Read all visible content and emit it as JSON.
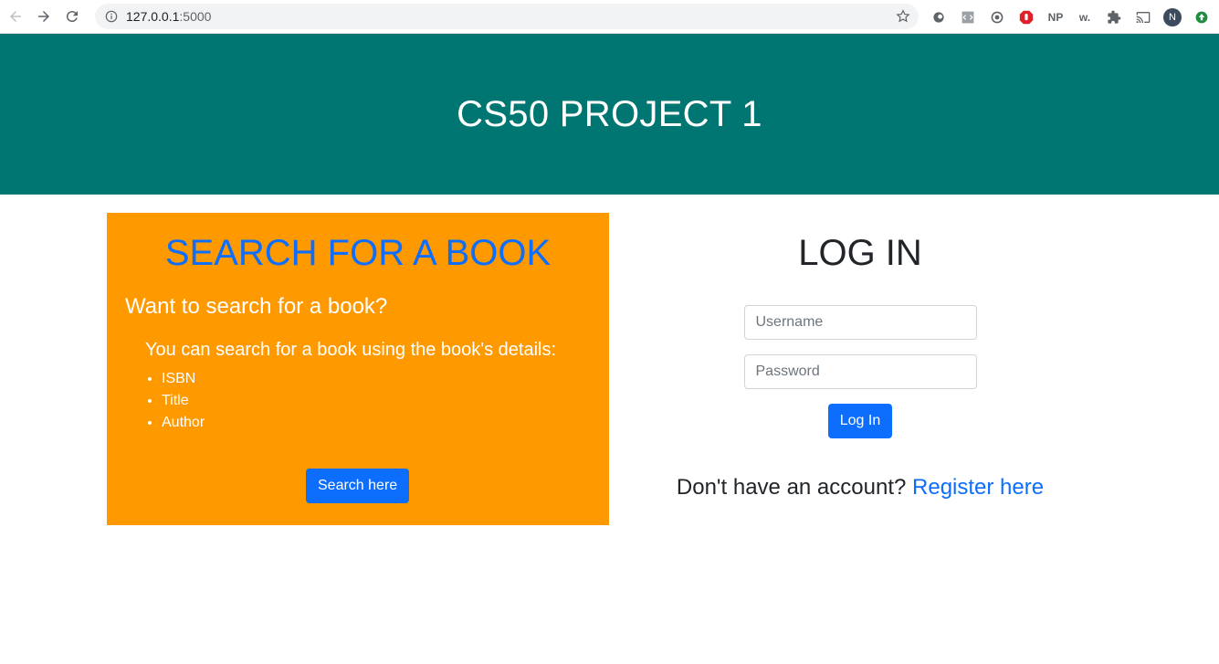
{
  "browser": {
    "url_host": "127.0.0.1",
    "url_port": ":5000",
    "extensions": [
      "NP",
      "w."
    ],
    "profile_initial": "N"
  },
  "header": {
    "title": "CS50 PROJECT 1"
  },
  "search": {
    "title": "SEARCH FOR A BOOK",
    "question": "Want to search for a book?",
    "subtitle": "You can search for a book using the book's details:",
    "fields": [
      "ISBN",
      "Title",
      "Author"
    ],
    "button_label": "Search here"
  },
  "login": {
    "title": "LOG IN",
    "username_placeholder": "Username",
    "password_placeholder": "Password",
    "button_label": "Log In",
    "register_prompt": "Don't have an account?",
    "register_link": "Register here"
  },
  "colors": {
    "header_bg": "#007672",
    "card_bg": "#ff9900",
    "primary": "#0d6efd"
  }
}
